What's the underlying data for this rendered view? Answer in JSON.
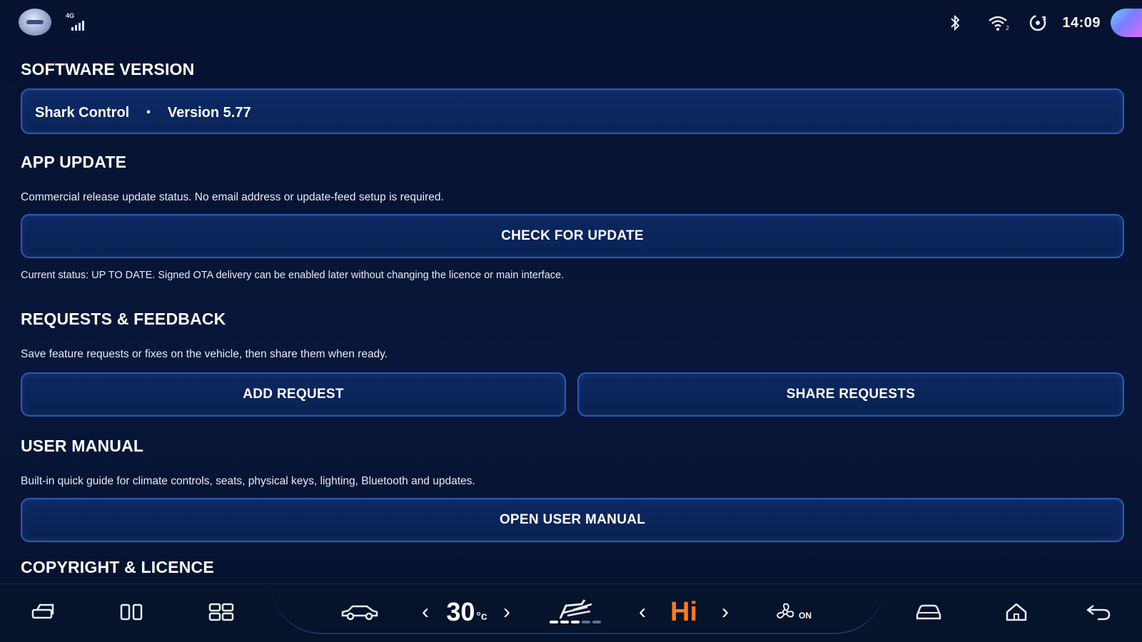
{
  "status_bar": {
    "network": "4G",
    "time": "14:09",
    "icons": [
      "launcher-icon",
      "signal-icon",
      "bluetooth-icon",
      "wifi-icon",
      "hotspot-icon",
      "assistant-orb-icon"
    ]
  },
  "software_version": {
    "title": "SOFTWARE VERSION",
    "app_name": "Shark Control",
    "separator": "•",
    "version": "Version 5.77"
  },
  "app_update": {
    "title": "APP UPDATE",
    "description": "Commercial release update status. No email address or update-feed setup is required.",
    "button_label": "CHECK FOR UPDATE",
    "status_text": "Current status: UP TO DATE. Signed OTA delivery can be enabled later without changing the licence or main interface."
  },
  "requests": {
    "title": "REQUESTS & FEEDBACK",
    "description": "Save feature requests or fixes on the vehicle, then share them when ready.",
    "add_label": "ADD REQUEST",
    "share_label": "SHARE REQUESTS"
  },
  "user_manual": {
    "title": "USER MANUAL",
    "description": "Built-in quick guide for climate controls, seats, physical keys, lighting, Bluetooth and updates.",
    "button_label": "OPEN USER MANUAL"
  },
  "copyright": {
    "title": "COPYRIGHT & LICENCE"
  },
  "bottom_bar": {
    "temperature": "30",
    "temperature_unit": "°c",
    "chevron_left": "‹",
    "chevron_right": "›",
    "fan_level": "Hi",
    "fan_state": "ON",
    "accent_color": "#ff7a1a",
    "seat_heat_level": 3,
    "seat_heat_max": 5
  },
  "colors": {
    "background": "#061330",
    "panel": "#0c2860",
    "border": "#2a5bb8"
  }
}
